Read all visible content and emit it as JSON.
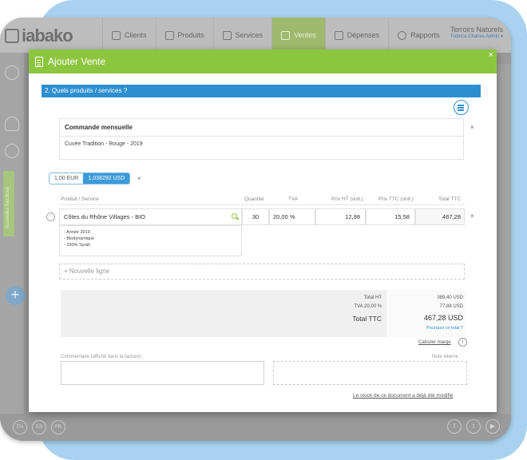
{
  "app": {
    "logo": "iabako",
    "nav": [
      "Clients",
      "Produits",
      "Services",
      "Ventes",
      "Dépenses",
      "Rapports"
    ],
    "active_nav": "Ventes",
    "org": "Terroirs Naturels",
    "user": "Fabrice Charles Admin"
  },
  "rail": {
    "green_tab": "Nouvelles fonctions"
  },
  "bottom": {
    "langs": [
      "EN",
      "ES",
      "FR"
    ],
    "social": [
      "f",
      "t",
      "▶"
    ]
  },
  "modal": {
    "title": "Ajouter Vente",
    "close": "×",
    "section_title": "2. Quels produits / services ?",
    "template": {
      "title": "Commande mensuelle",
      "subtitle": "Cuvée Tradition - Rouge - 2019"
    },
    "currency": {
      "left": "1,00 EUR",
      "right": "1,038292 USD"
    },
    "remove": "×",
    "table": {
      "headers": [
        "Produit / Service",
        "Quantité",
        "TVA",
        "Prix HT (unit.)",
        "Prix TTC (unit.)",
        "Total TTC"
      ],
      "row": {
        "product": "Côtes du Rhône Villages - BIO",
        "qty": "30",
        "vat": "20,00 %",
        "price_ht": "12,98",
        "price_ttc": "15,58",
        "total_ttc": "467,28",
        "details": [
          "- Année 2019",
          "- Biodynamique",
          "- 100% Syrah"
        ]
      }
    },
    "new_line": "+ Nouvelle ligne",
    "totals": {
      "total_ht_label": "Total HT",
      "total_ht": "389,40 USD",
      "vat_label": "TVA 20,00 %",
      "vat": "77,88 USD",
      "total_ttc_label": "Total TTC",
      "total_ttc": "467,28 USD",
      "why_total": "Pourquoi ce total ?"
    },
    "calc_margin": "Calculer marge",
    "info": "i",
    "comment_label": "Commentaire (affiché dans la facture) :",
    "note_label": "Note interne :",
    "stock_link": "Le stock de ce document a déjà été modifié"
  }
}
